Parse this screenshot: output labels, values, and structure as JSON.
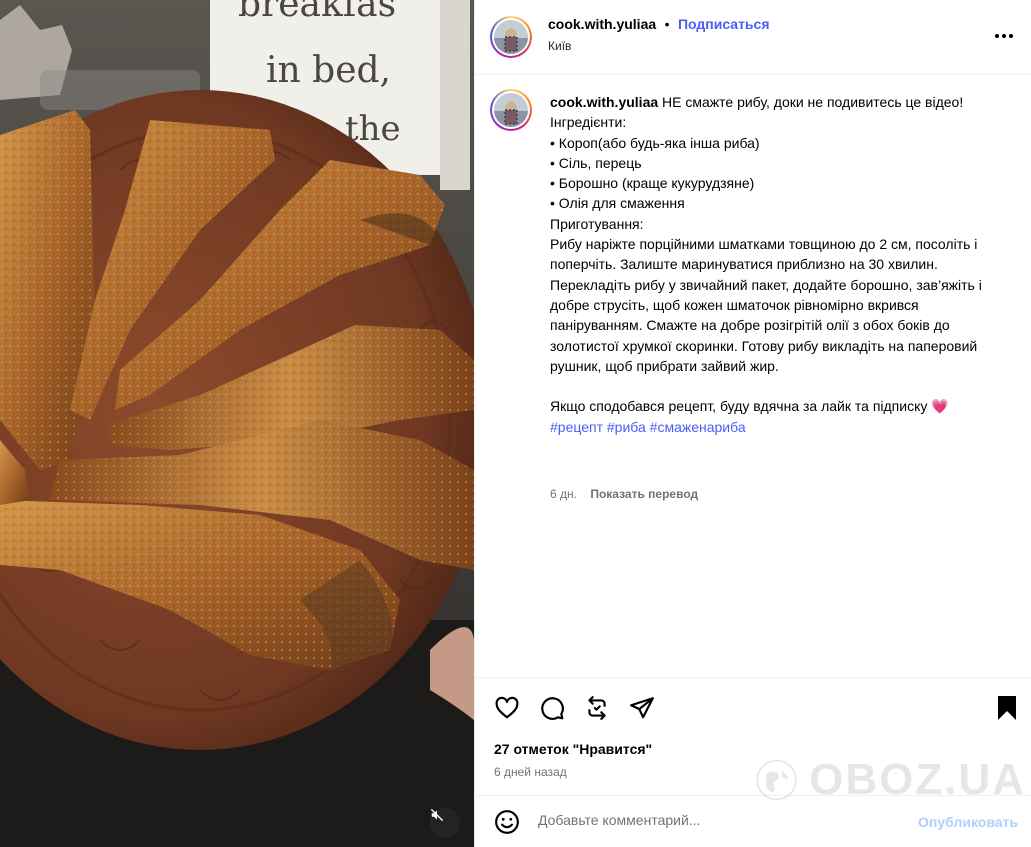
{
  "post": {
    "username": "cook.with.yuliaa",
    "separator": "•",
    "follow_label": "Подписаться",
    "location": "Київ",
    "more_icon": "more-horizontal-icon"
  },
  "caption": {
    "username": "cook.with.yuliaa",
    "lines": [
      "НЕ смажте рибу, доки не подивитесь це відео!",
      "Інгредієнти:",
      "• Короп(або будь-яка інша риба)",
      "• Сіль, перець",
      "• Борошно (краще кукурудзяне)",
      "• Олія для смаження",
      "Приготування:",
      "Рибу наріжте порційними шматками товщиною до 2 см, посоліть і поперчіть. Залиште маринуватися приблизно на 30 хвилин. Перекладіть рибу у звичайний пакет, додайте борошно, зав’яжіть і добре струсіть, щоб кожен шматочок рівномірно вкрився паніруванням. Смажте на добре розігрітій олії з обох боків до золотистої хрумкої скоринки. Готову рибу викладіть на паперовий рушник, щоб прибрати зайвий жир.",
      "",
      "Якщо сподобався рецепт, буду вдячна за лайк та підписку 💗"
    ],
    "hashtags": "#рецепт #риба #смаженариба",
    "age": "6 дн.",
    "translate_label": "Показать перевод"
  },
  "media": {
    "sign_lines": [
      "breakfas",
      "in bed,",
      "the"
    ],
    "mute_icon": "volume-muted-icon"
  },
  "actions": {
    "like_icon": "heart-icon",
    "comment_icon": "comment-icon",
    "share_icon": "repost-icon",
    "send_icon": "send-icon",
    "save_icon": "bookmark-icon"
  },
  "likes_text": "27 отметок \"Нравится\"",
  "date_text": "6 дней назад",
  "comment": {
    "placeholder": "Добавьте комментарий...",
    "value": "",
    "publish_label": "Опубликовать",
    "emoji_icon": "emoji-icon"
  },
  "watermark": {
    "text": "OBOZ.UA"
  },
  "colors": {
    "link": "#4a5df9",
    "secondary_text": "#737373",
    "publish_disabled": "#b2cffa",
    "border": "#efefef",
    "plate": "#7a3f26",
    "fried_crust": "#b7712f"
  }
}
